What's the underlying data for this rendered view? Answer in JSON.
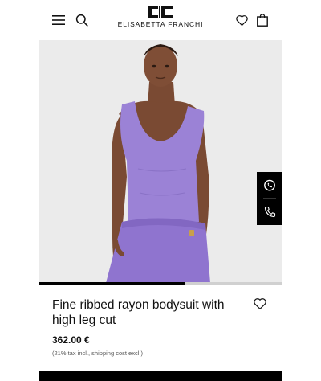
{
  "header": {
    "brand_name": "ELISABETTA FRANCHI",
    "icons": [
      "menu-icon",
      "search-icon",
      "heart-icon",
      "shopping-bag-icon"
    ]
  },
  "gallery": {
    "image_description_icon": "product-photo",
    "progress": 0.6
  },
  "contact": {
    "icons": [
      "whatsapp-icon",
      "phone-icon"
    ]
  },
  "product": {
    "title": "Fine ribbed rayon bodysuit with high leg cut",
    "price": "362.00 €",
    "tax_note": "(21% tax incl., shipping cost excl.)"
  },
  "colors": {
    "bodysuit": "#9b82d6",
    "skirt": "#8f74cf",
    "background": "#ebebeb",
    "accent": "#000000"
  }
}
